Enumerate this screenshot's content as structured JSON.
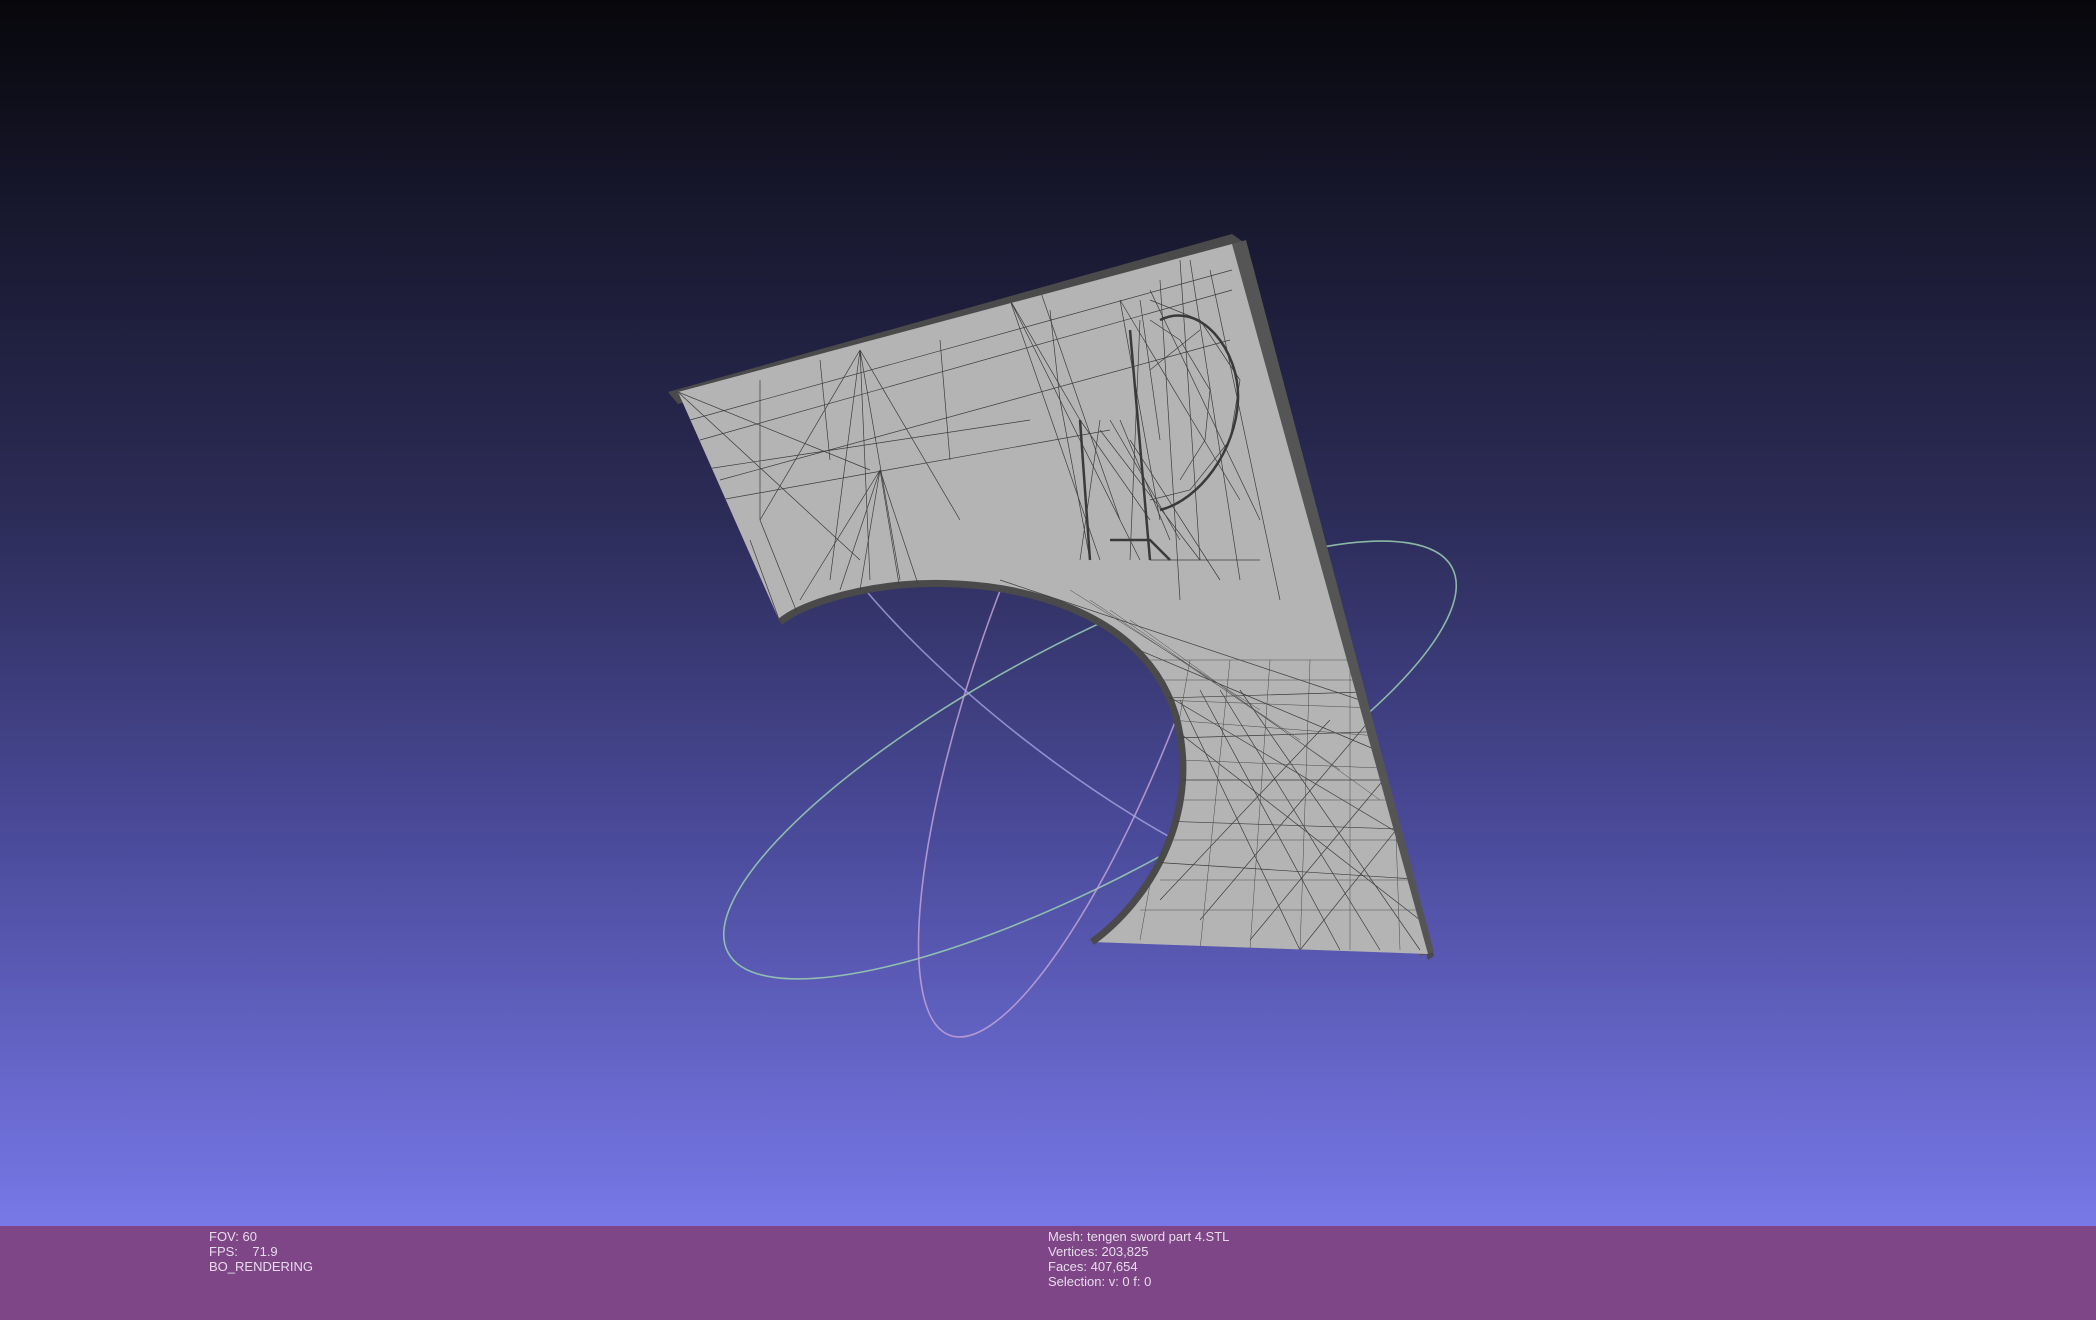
{
  "render_info": {
    "fov": "FOV: 60",
    "fps_label": "FPS:",
    "fps_value": "71.9",
    "mode": "BO_RENDERING"
  },
  "mesh_info": {
    "mesh": "Mesh: tengen sword part 4.STL",
    "vertices": "Vertices: 203,825",
    "faces": "Faces: 407,654",
    "selection": "Selection: v: 0 f: 0"
  },
  "colors": {
    "status_bar": "#7e4686",
    "mesh_face": "#b4b4b4",
    "mesh_edge": "#3c3c3c",
    "background_top": "#07070b",
    "background_bottom": "#7878e8"
  },
  "icons": {
    "trackball": "trackball-gizmo-icon"
  }
}
